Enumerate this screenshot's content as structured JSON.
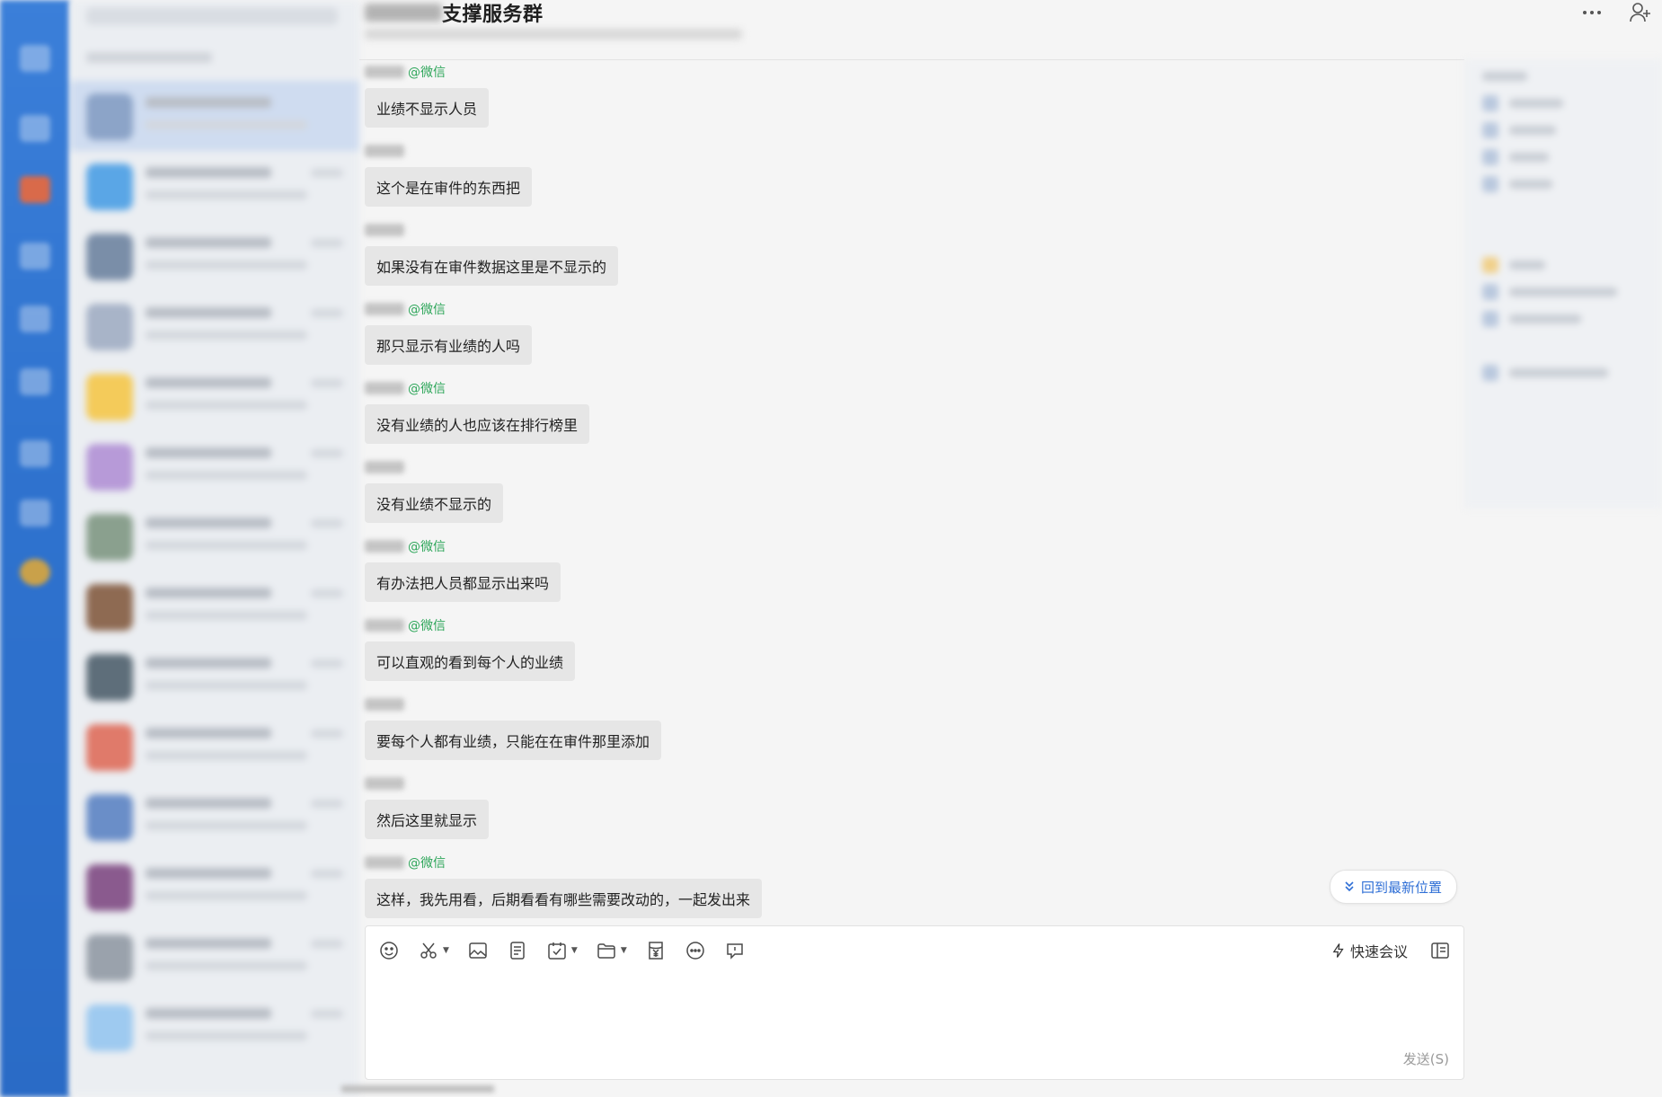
{
  "header": {
    "title": "支撑服务群",
    "more_icon": "more-icon",
    "add_member_icon": "add-member-icon"
  },
  "messages": [
    {
      "at": "@微信",
      "text": "业绩不显示人员"
    },
    {
      "at": "",
      "text": "这个是在审件的东西把"
    },
    {
      "at": "",
      "text": "如果没有在审件数据这里是不显示的"
    },
    {
      "at": "@微信",
      "text": "那只显示有业绩的人吗"
    },
    {
      "at": "@微信",
      "text": "没有业绩的人也应该在排行榜里"
    },
    {
      "at": "",
      "text": "没有业绩不显示的"
    },
    {
      "at": "@微信",
      "text": "有办法把人员都显示出来吗"
    },
    {
      "at": "@微信",
      "text": "可以直观的看到每个人的业绩"
    },
    {
      "at": "",
      "text": "要每个人都有业绩，只能在在审件那里添加"
    },
    {
      "at": "",
      "text": "然后这里就显示"
    },
    {
      "at": "@微信",
      "text": "这样，我先用看，后期看看有哪些需要改动的，一起发出来"
    }
  ],
  "jump_latest": {
    "label": "回到最新位置"
  },
  "composer": {
    "tools": [
      "emoji-icon",
      "screenshot-icon",
      "image-icon",
      "document-icon",
      "task-icon",
      "folder-icon",
      "red-packet-icon",
      "more-dots-icon",
      "chat-record-icon"
    ],
    "quick_meeting_label": "快速会议",
    "send_label": "发送(S)"
  },
  "colors": {
    "accent": "#2f6fd6",
    "at_green": "#2ea65a",
    "bubble": "#e6e6e6",
    "rail": "#2f73cf"
  }
}
